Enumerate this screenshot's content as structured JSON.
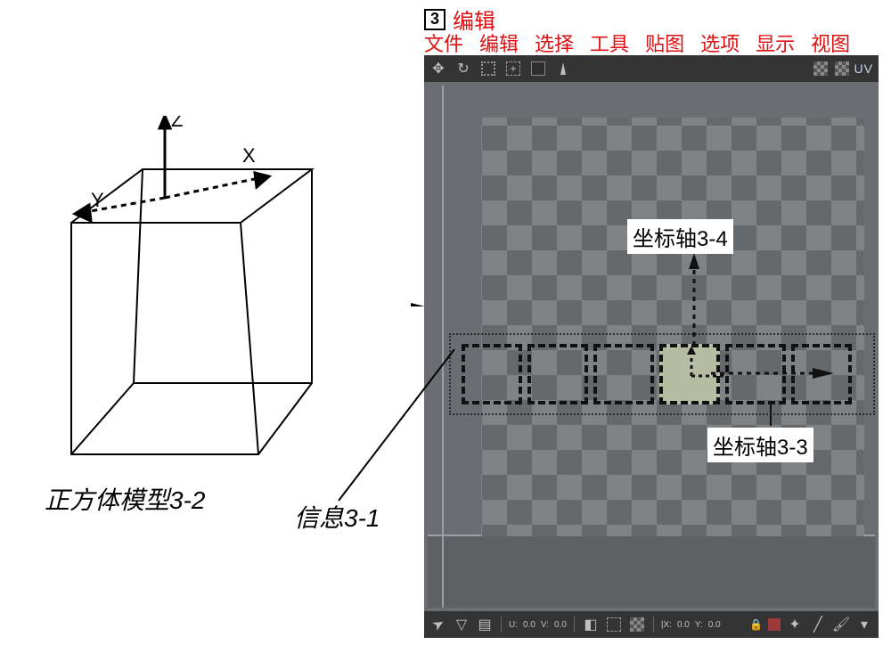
{
  "title_row": {
    "num": "3",
    "mode": "编辑"
  },
  "menu": [
    "文件",
    "编辑",
    "选择",
    "工具",
    "贴图",
    "选项",
    "显示",
    "视图"
  ],
  "toolbar_right": {
    "uv": "UV"
  },
  "cube": {
    "label": "正方体模型3-2",
    "axes": {
      "x": "X",
      "y": "Y",
      "z": "Z"
    }
  },
  "callouts": {
    "axis_v": "坐标轴3-4",
    "axis_h": "坐标轴3-3",
    "info": "信息3-1"
  },
  "status": {
    "u_label": "U:",
    "u_val": "0.0",
    "v_label": "V:",
    "v_val": "0.0",
    "x_label": "|X:",
    "x_val": "0.0",
    "y_label": "Y:",
    "y_val": "0.0",
    "lock": "🔒"
  },
  "icons": {
    "move": "move-icon",
    "rotate": "rotate-icon",
    "sel_box": "select-box-icon",
    "sel_plus": "select-add-icon",
    "sq": "rect-icon",
    "brush": "brush-icon",
    "grid1": "grid-icon",
    "grid2": "grid-alt-icon"
  }
}
